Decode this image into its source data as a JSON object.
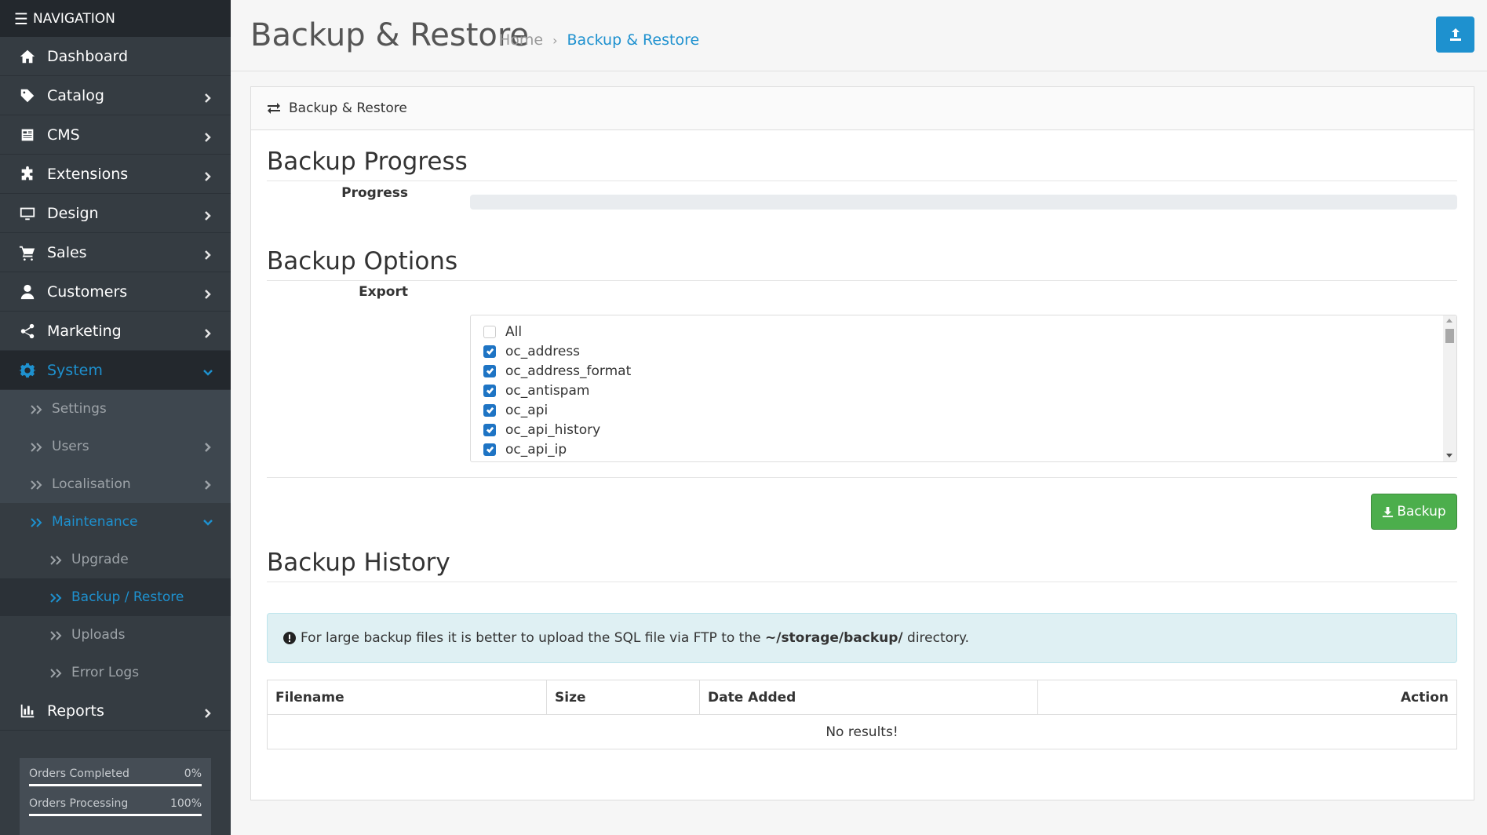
{
  "nav": {
    "header": "NAVIGATION",
    "items": [
      {
        "label": "Dashboard",
        "icon": "home-icon"
      },
      {
        "label": "Catalog",
        "icon": "tag-icon"
      },
      {
        "label": "CMS",
        "icon": "newspaper-icon"
      },
      {
        "label": "Extensions",
        "icon": "puzzle-icon"
      },
      {
        "label": "Design",
        "icon": "desktop-icon"
      },
      {
        "label": "Sales",
        "icon": "cart-icon"
      },
      {
        "label": "Customers",
        "icon": "user-icon"
      },
      {
        "label": "Marketing",
        "icon": "share-icon"
      },
      {
        "label": "System",
        "icon": "gear-icon"
      },
      {
        "label": "Reports",
        "icon": "chart-icon"
      }
    ],
    "system_sub": [
      "Settings",
      "Users",
      "Localisation",
      "Maintenance"
    ],
    "maintenance_sub": [
      "Upgrade",
      "Backup / Restore",
      "Uploads",
      "Error Logs"
    ],
    "stats": [
      {
        "label": "Orders Completed",
        "value": "0%"
      },
      {
        "label": "Orders Processing",
        "value": "100%"
      }
    ]
  },
  "header": {
    "title": "Backup & Restore",
    "breadcrumb_home": "Home",
    "breadcrumb_current": "Backup & Restore"
  },
  "card": {
    "title": "Backup & Restore",
    "progress_section": "Backup Progress",
    "progress_label": "Progress",
    "progress_value": 0,
    "options_section": "Backup Options",
    "export_label": "Export",
    "export_items": [
      {
        "label": "All",
        "checked": false
      },
      {
        "label": "oc_address",
        "checked": true
      },
      {
        "label": "oc_address_format",
        "checked": true
      },
      {
        "label": "oc_antispam",
        "checked": true
      },
      {
        "label": "oc_api",
        "checked": true
      },
      {
        "label": "oc_api_history",
        "checked": true
      },
      {
        "label": "oc_api_ip",
        "checked": true
      }
    ],
    "backup_button": "Backup",
    "history_section": "Backup History",
    "alert_prefix": "For large backup files it is better to upload the SQL file via FTP to the",
    "alert_path": "~/storage/backup/",
    "alert_suffix": "directory.",
    "table": {
      "headers": [
        "Filename",
        "Size",
        "Date Added",
        "Action"
      ],
      "empty": "No results!"
    }
  },
  "colors": {
    "sidebar_bg": "#353c42",
    "accent": "#1e91cf",
    "success": "#4cae4c"
  }
}
